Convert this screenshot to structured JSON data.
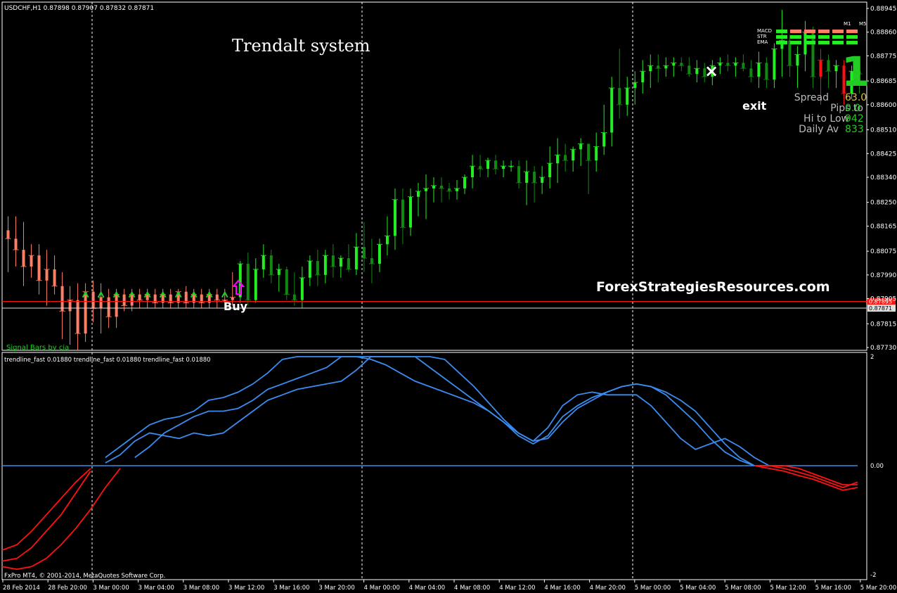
{
  "header": {
    "title": "USDCHF,H1  0.87898 0.87907 0.87832 0.87871",
    "system_title": "Trendalt system",
    "watermark": "ForexStrategiesResources.com",
    "footer": "FxPro MT4, © 2001-2014, MetaQuotes Software Corp.",
    "indicator_label": "Signal Bars by cja",
    "sub_title": "trendline_fast 0.01880  trendline_fast 0.01880  trendline_fast 0.01880"
  },
  "annotations": {
    "buy": "Buy",
    "exit": "exit",
    "exit_mark": "×"
  },
  "panel": {
    "labels": [
      "MACD",
      "STR",
      "EMA"
    ],
    "timeframes": [
      "M1",
      "M5"
    ],
    "stats": [
      {
        "label": "Spread",
        "value": "63.0",
        "color": "#d4c64a"
      },
      {
        "label": "Pips to",
        "value": "0.0",
        "color": "#22cc22"
      },
      {
        "label": "Hi to Low",
        "value": "942",
        "color": "#22cc22"
      },
      {
        "label": "Daily Av",
        "value": "833",
        "color": "#22cc22"
      }
    ],
    "big_signal": "1"
  },
  "colors": {
    "up_bull": "#22ee22",
    "dn_bull": "#118811",
    "up_bear": "#ff7f66",
    "bear_red": "#ff1111",
    "line_blue": "#3b8cf0",
    "line_red": "#ff1111",
    "buy_arrow": "#ff00ff"
  },
  "chart_data": [
    {
      "type": "candlestick",
      "symbol": "USDCHF",
      "timeframe": "H1",
      "ylim": [
        0.8773,
        0.8896
      ],
      "price_ticks": [
        "0.88945",
        "0.88860",
        "0.88775",
        "0.88685",
        "0.88600",
        "0.88510",
        "0.88425",
        "0.88340",
        "0.88250",
        "0.88165",
        "0.88075",
        "0.87990",
        "0.87905",
        "0.87815",
        "0.87730"
      ],
      "price_tick_values": [
        0.88945,
        0.8886,
        0.88775,
        0.88685,
        0.886,
        0.8851,
        0.88425,
        0.8834,
        0.8825,
        0.88165,
        0.88075,
        0.8799,
        0.87905,
        0.87815,
        0.8773
      ],
      "price_lines": [
        {
          "label": "0.87895",
          "value": 0.87895,
          "color": "#ff1111"
        },
        {
          "label": "0.87871",
          "value": 0.87871,
          "color": "#dddddd"
        }
      ],
      "x_labels": [
        "28 Feb 2014",
        "28 Feb 20:00",
        "3 Mar 00:00",
        "3 Mar 04:00",
        "3 Mar 08:00",
        "3 Mar 12:00",
        "3 Mar 16:00",
        "3 Mar 20:00",
        "4 Mar 00:00",
        "4 Mar 04:00",
        "4 Mar 08:00",
        "4 Mar 12:00",
        "4 Mar 16:00",
        "4 Mar 20:00",
        "5 Mar 00:00",
        "5 Mar 04:00",
        "5 Mar 08:00",
        "5 Mar 12:00",
        "5 Mar 16:00",
        "5 Mar 20:00"
      ],
      "candles": [
        [
          0.8815,
          0.882,
          0.88,
          0.8812
        ],
        [
          0.8812,
          0.882,
          0.8802,
          0.8808
        ],
        [
          0.8808,
          0.8818,
          0.8795,
          0.8802
        ],
        [
          0.8802,
          0.881,
          0.8798,
          0.8806
        ],
        [
          0.8806,
          0.881,
          0.8792,
          0.8797
        ],
        [
          0.8797,
          0.8808,
          0.8788,
          0.8801
        ],
        [
          0.8801,
          0.8806,
          0.8792,
          0.8795
        ],
        [
          0.8795,
          0.88,
          0.8776,
          0.8786
        ],
        [
          0.8786,
          0.8795,
          0.8774,
          0.879
        ],
        [
          0.879,
          0.8796,
          0.8772,
          0.8778
        ],
        [
          0.8778,
          0.8796,
          0.8775,
          0.8793
        ],
        [
          0.8793,
          0.8797,
          0.8782,
          0.8787
        ],
        [
          0.8787,
          0.8796,
          0.8778,
          0.8791
        ],
        [
          0.8791,
          0.8794,
          0.878,
          0.8784
        ],
        [
          0.8784,
          0.8794,
          0.878,
          0.8792
        ],
        [
          0.8792,
          0.8794,
          0.8786,
          0.8788
        ],
        [
          0.8788,
          0.8794,
          0.8786,
          0.8792
        ],
        [
          0.8792,
          0.8794,
          0.8787,
          0.879
        ],
        [
          0.879,
          0.8794,
          0.8787,
          0.8792
        ],
        [
          0.8792,
          0.8794,
          0.8787,
          0.8789
        ],
        [
          0.8789,
          0.8794,
          0.8787,
          0.8792
        ],
        [
          0.8792,
          0.8794,
          0.8787,
          0.8789
        ],
        [
          0.8789,
          0.8794,
          0.8787,
          0.8793
        ],
        [
          0.8793,
          0.8795,
          0.8787,
          0.8789
        ],
        [
          0.8789,
          0.8794,
          0.8787,
          0.8792
        ],
        [
          0.8792,
          0.8794,
          0.8787,
          0.8789
        ],
        [
          0.8789,
          0.8794,
          0.8787,
          0.8792
        ],
        [
          0.8792,
          0.8794,
          0.8787,
          0.879
        ],
        [
          0.879,
          0.8794,
          0.8787,
          0.879
        ],
        [
          0.879,
          0.88,
          0.8788,
          0.8791
        ],
        [
          0.8791,
          0.8804,
          0.8789,
          0.8803
        ],
        [
          0.8803,
          0.8807,
          0.8788,
          0.879
        ],
        [
          0.879,
          0.8805,
          0.8789,
          0.8801
        ],
        [
          0.8801,
          0.881,
          0.8798,
          0.8806
        ],
        [
          0.8806,
          0.8808,
          0.8796,
          0.8799
        ],
        [
          0.8799,
          0.8803,
          0.8793,
          0.8801
        ],
        [
          0.8801,
          0.8802,
          0.879,
          0.8792
        ],
        [
          0.8792,
          0.88,
          0.8788,
          0.879
        ],
        [
          0.879,
          0.8802,
          0.8787,
          0.8798
        ],
        [
          0.8798,
          0.8806,
          0.8795,
          0.8804
        ],
        [
          0.8804,
          0.8808,
          0.8795,
          0.8799
        ],
        [
          0.8799,
          0.8808,
          0.8796,
          0.8806
        ],
        [
          0.8806,
          0.881,
          0.8798,
          0.8802
        ],
        [
          0.8802,
          0.8806,
          0.8798,
          0.8805
        ],
        [
          0.8805,
          0.881,
          0.88,
          0.8801
        ],
        [
          0.8801,
          0.8814,
          0.8799,
          0.8809
        ],
        [
          0.8809,
          0.8818,
          0.88,
          0.8805
        ],
        [
          0.8805,
          0.8812,
          0.8796,
          0.8803
        ],
        [
          0.8803,
          0.8812,
          0.88,
          0.881
        ],
        [
          0.881,
          0.882,
          0.8806,
          0.8813
        ],
        [
          0.8813,
          0.883,
          0.8808,
          0.8826
        ],
        [
          0.8826,
          0.883,
          0.881,
          0.8816
        ],
        [
          0.8816,
          0.883,
          0.8813,
          0.8827
        ],
        [
          0.8827,
          0.8832,
          0.882,
          0.8829
        ],
        [
          0.8829,
          0.8835,
          0.8819,
          0.883
        ],
        [
          0.883,
          0.8834,
          0.8825,
          0.8831
        ],
        [
          0.8831,
          0.8834,
          0.8825,
          0.883
        ],
        [
          0.883,
          0.8832,
          0.8826,
          0.8829
        ],
        [
          0.8829,
          0.8833,
          0.8826,
          0.883
        ],
        [
          0.883,
          0.8835,
          0.8828,
          0.8834
        ],
        [
          0.8834,
          0.8842,
          0.883,
          0.8838
        ],
        [
          0.8838,
          0.8842,
          0.8834,
          0.8837
        ],
        [
          0.8837,
          0.8841,
          0.8834,
          0.884
        ],
        [
          0.884,
          0.8842,
          0.8835,
          0.8837
        ],
        [
          0.8837,
          0.884,
          0.8834,
          0.8838
        ],
        [
          0.8838,
          0.884,
          0.8836,
          0.8838
        ],
        [
          0.8838,
          0.884,
          0.883,
          0.8832
        ],
        [
          0.8832,
          0.884,
          0.8824,
          0.8836
        ],
        [
          0.8836,
          0.8838,
          0.8825,
          0.8832
        ],
        [
          0.8832,
          0.8838,
          0.8828,
          0.8834
        ],
        [
          0.8834,
          0.8845,
          0.883,
          0.8839
        ],
        [
          0.8839,
          0.8848,
          0.8832,
          0.8842
        ],
        [
          0.8842,
          0.8846,
          0.8836,
          0.884
        ],
        [
          0.884,
          0.8845,
          0.8836,
          0.8844
        ],
        [
          0.8844,
          0.8848,
          0.8838,
          0.8846
        ],
        [
          0.8846,
          0.8845,
          0.8828,
          0.884
        ],
        [
          0.884,
          0.885,
          0.8836,
          0.8845
        ],
        [
          0.8845,
          0.886,
          0.8842,
          0.885
        ],
        [
          0.885,
          0.887,
          0.8845,
          0.8866
        ],
        [
          0.8866,
          0.888,
          0.8855,
          0.886
        ],
        [
          0.886,
          0.887,
          0.8856,
          0.8866
        ],
        [
          0.8866,
          0.8872,
          0.886,
          0.8868
        ],
        [
          0.8868,
          0.8876,
          0.8864,
          0.8872
        ],
        [
          0.8872,
          0.8878,
          0.8866,
          0.8874
        ],
        [
          0.8874,
          0.8878,
          0.8868,
          0.8873
        ],
        [
          0.8873,
          0.8877,
          0.887,
          0.8874
        ],
        [
          0.8874,
          0.8877,
          0.887,
          0.8875
        ],
        [
          0.8875,
          0.8877,
          0.8872,
          0.8874
        ],
        [
          0.8874,
          0.8877,
          0.887,
          0.8871
        ],
        [
          0.8871,
          0.8876,
          0.8868,
          0.8873
        ],
        [
          0.8873,
          0.8875,
          0.8868,
          0.887
        ],
        [
          0.887,
          0.8876,
          0.8867,
          0.8874
        ],
        [
          0.8874,
          0.8877,
          0.8871,
          0.8875
        ],
        [
          0.8875,
          0.8878,
          0.8872,
          0.8874
        ],
        [
          0.8874,
          0.8877,
          0.887,
          0.8875
        ],
        [
          0.8875,
          0.8878,
          0.8872,
          0.8873
        ],
        [
          0.8873,
          0.8876,
          0.8868,
          0.887
        ],
        [
          0.887,
          0.8879,
          0.8866,
          0.8875
        ],
        [
          0.8875,
          0.8877,
          0.8866,
          0.8869
        ],
        [
          0.8869,
          0.8882,
          0.8866,
          0.888
        ],
        [
          0.888,
          0.8894,
          0.887,
          0.8883
        ],
        [
          0.8883,
          0.8885,
          0.887,
          0.8874
        ],
        [
          0.8874,
          0.8881,
          0.8866,
          0.8878
        ],
        [
          0.8878,
          0.889,
          0.8872,
          0.8886
        ],
        [
          0.8886,
          0.8888,
          0.8866,
          0.887
        ],
        [
          0.887,
          0.888,
          0.886,
          0.8876
        ],
        [
          0.8876,
          0.8878,
          0.8866,
          0.8872
        ],
        [
          0.8872,
          0.8876,
          0.8866,
          0.8874
        ],
        [
          0.8874,
          0.8876,
          0.886,
          0.8864
        ],
        [
          0.8864,
          0.8874,
          0.8862,
          0.8872
        ],
        [
          0.8872,
          0.8874,
          0.8864,
          0.8871
        ]
      ]
    },
    {
      "type": "line",
      "title": "trendline_fast 0.01880",
      "ylim": [
        -2,
        2
      ],
      "y_ticks": [
        "2",
        "0.00",
        "-2"
      ],
      "y_tick_values": [
        2,
        0,
        -2
      ],
      "series": [
        {
          "values": [
            -1.55,
            -1.45,
            -1.2,
            -0.9,
            -0.6,
            -0.3,
            -0.05,
            0.05,
            0.2,
            0.45,
            0.6,
            0.55,
            0.5,
            0.6,
            0.55,
            0.6,
            0.8,
            1.0,
            1.2,
            1.3,
            1.4,
            1.45,
            1.5,
            1.55,
            1.75,
            2.0,
            2.2,
            2.3,
            2.3,
            2.15,
            1.95,
            1.7,
            1.45,
            1.15,
            0.85,
            0.6,
            0.45,
            0.7,
            1.1,
            1.3,
            1.35,
            1.3,
            1.3,
            1.3,
            1.1,
            0.8,
            0.5,
            0.3,
            0.4,
            0.5,
            0.35,
            0.15,
            0.0,
            0.0,
            -0.05,
            -0.15,
            -0.25,
            -0.35,
            -0.35
          ]
        },
        {
          "values": [
            -1.85,
            -1.9,
            -1.85,
            -1.7,
            -1.45,
            -1.15,
            -0.8,
            -0.4,
            -0.05,
            0.15,
            0.35,
            0.6,
            0.75,
            0.9,
            1.0,
            1.0,
            1.05,
            1.2,
            1.4,
            1.5,
            1.6,
            1.7,
            1.8,
            2.0,
            2.3,
            2.5,
            2.4,
            2.2,
            2.0,
            1.8,
            1.6,
            1.4,
            1.2,
            1.0,
            0.8,
            0.6,
            0.45,
            0.5,
            0.8,
            1.05,
            1.2,
            1.35,
            1.45,
            1.5,
            1.45,
            1.3,
            1.05,
            0.8,
            0.5,
            0.25,
            0.1,
            0.0,
            0.0,
            -0.05,
            -0.12,
            -0.2,
            -0.3,
            -0.4,
            -0.3
          ]
        },
        {
          "values": [
            -1.75,
            -1.7,
            -1.5,
            -1.2,
            -0.9,
            -0.5,
            -0.1,
            0.15,
            0.35,
            0.55,
            0.75,
            0.85,
            0.9,
            1.0,
            1.2,
            1.25,
            1.35,
            1.5,
            1.7,
            1.95,
            2.3,
            2.4,
            2.3,
            2.25,
            2.1,
            1.95,
            1.85,
            1.7,
            1.55,
            1.45,
            1.35,
            1.25,
            1.15,
            1.0,
            0.8,
            0.55,
            0.4,
            0.55,
            0.9,
            1.1,
            1.25,
            1.35,
            1.45,
            1.5,
            1.45,
            1.35,
            1.2,
            1.0,
            0.7,
            0.4,
            0.15,
            0.0,
            -0.05,
            -0.1,
            -0.18,
            -0.25,
            -0.35,
            -0.45,
            -0.4
          ]
        }
      ]
    }
  ]
}
